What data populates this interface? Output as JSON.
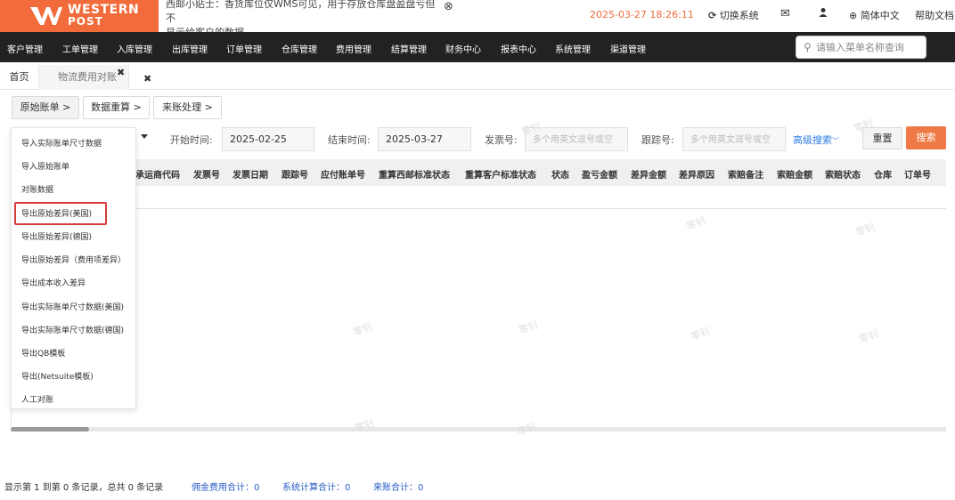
{
  "brand": {
    "line1": "WESTERN",
    "line2": "POST"
  },
  "header": {
    "notice_line1": "西邮小贴士：香货库位仅WMS可见，用于存放仓库盘盈盘亏但不",
    "notice_line2": "显示给客户的数据。",
    "datetime": "2025-03-27 18:26:11",
    "switch_system": "切换系统",
    "language": "简体中文",
    "help": "帮助文档"
  },
  "nav": {
    "items": [
      "客户管理",
      "工单管理",
      "入库管理",
      "出库管理",
      "订单管理",
      "仓库管理",
      "费用管理",
      "结算管理",
      "财务中心",
      "报表中心",
      "系统管理",
      "渠道管理"
    ],
    "search_placeholder": "请输入菜单名称查询"
  },
  "tabs": {
    "home": "首页",
    "current": "物流费用对账"
  },
  "subtabs": {
    "raw_bill": "原始账单 >",
    "recalc": "数据重算 >",
    "incoming": "来账处理 >"
  },
  "filters": {
    "start_label": "开始时间:",
    "start_value": "2025-02-25",
    "end_label": "结束时间:",
    "end_value": "2025-03-27",
    "invoice_label": "发票号:",
    "invoice_placeholder": "多个用英文逗号或空",
    "tracking_label": "跟踪号:",
    "tracking_placeholder": "多个用英文逗号或空",
    "advanced": "高级搜索",
    "reset": "重置",
    "search": "搜索"
  },
  "table": {
    "columns": [
      "承运商代码",
      "发票号",
      "发票日期",
      "跟踪号",
      "应付账单号",
      "重算西邮标准状态",
      "重算客户标准状态",
      "状态",
      "盈亏金额",
      "差异金额",
      "差异原因",
      "索赔备注",
      "索赔金额",
      "索赔状态",
      "仓库",
      "订单号"
    ]
  },
  "dropdown": {
    "items": [
      "导入实际账单尺寸数据",
      "导入原始账单",
      "对账数据",
      "导出原始差异(美国)",
      "导出原始差异(德国)",
      "导出原始差异（费用项差异）",
      "导出成本收入差异",
      "导出实际账单尺寸数据(美国)",
      "导出实际账单尺寸数据(德国)",
      "导出QB模板",
      "导出(Netsuite模板)",
      "人工对账"
    ],
    "highlighted": "导出原始差异(美国)"
  },
  "footer": {
    "records": "显示第 1 到第 0 条记录，总共 0 条记录",
    "commission": "佣金费用合计：0",
    "system_total": "系统计算合计：0",
    "incoming_total": "来账合计：0"
  },
  "watermark": "零钊",
  "colors": {
    "brand": "#f26b3a",
    "nav_bg": "#222222",
    "search_btn": "#f07a45",
    "link": "#2a7be4",
    "highlight_border": "#d63b3b"
  }
}
